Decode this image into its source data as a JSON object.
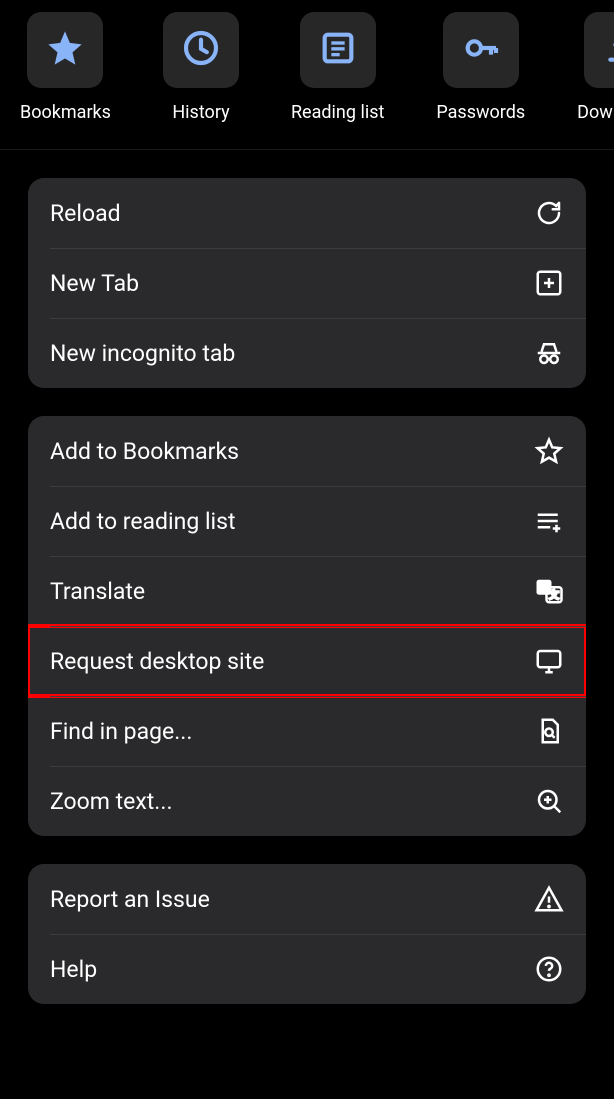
{
  "quick": [
    {
      "label": "Bookmarks"
    },
    {
      "label": "History"
    },
    {
      "label": "Reading list"
    },
    {
      "label": "Passwords"
    },
    {
      "label": "Downloads"
    }
  ],
  "group1": {
    "reload": "Reload",
    "newtab": "New Tab",
    "incognito": "New incognito tab"
  },
  "group2": {
    "addbm": "Add to Bookmarks",
    "addrl": "Add to reading list",
    "translate": "Translate",
    "desktop": "Request desktop site",
    "find": "Find in page...",
    "zoom": "Zoom text..."
  },
  "group3": {
    "report": "Report an Issue",
    "help": "Help"
  }
}
